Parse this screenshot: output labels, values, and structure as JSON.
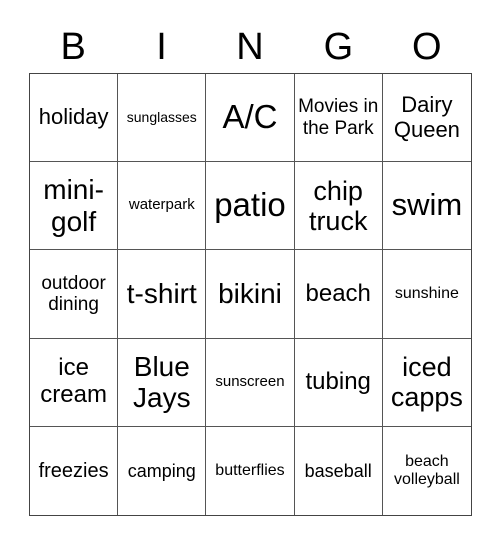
{
  "header": {
    "letters": [
      "B",
      "I",
      "N",
      "G",
      "O"
    ]
  },
  "cells": [
    [
      "holiday",
      "sunglasses",
      "A/C",
      "Movies in the Park",
      "Dairy Queen"
    ],
    [
      "mini-golf",
      "waterpark",
      "patio",
      "chip truck",
      "swim"
    ],
    [
      "outdoor dining",
      "t-shirt",
      "bikini",
      "beach",
      "sunshine"
    ],
    [
      "ice cream",
      "Blue Jays",
      "sunscreen",
      "tubing",
      "iced capps"
    ],
    [
      "freezies",
      "camping",
      "butterflies",
      "baseball",
      "beach volleyball"
    ]
  ]
}
